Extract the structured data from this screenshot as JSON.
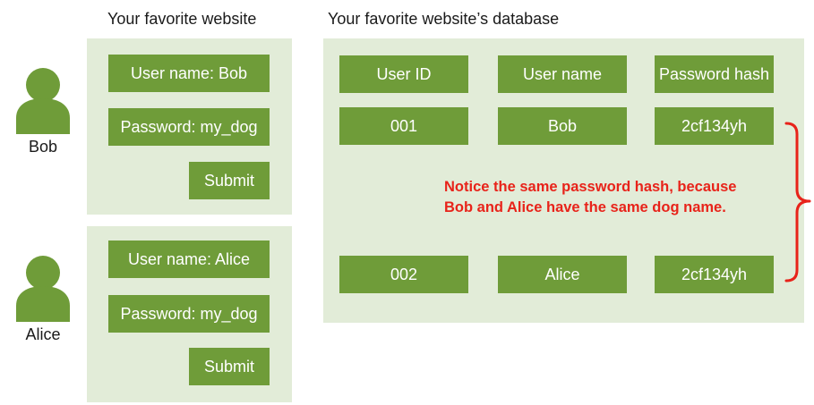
{
  "headings": {
    "website": "Your favorite website",
    "database": "Your favorite website’s database"
  },
  "users": {
    "bob": {
      "name": "Bob",
      "username_field": "User name: Bob",
      "password_field": "Password: my_dog",
      "submit": "Submit"
    },
    "alice": {
      "name": "Alice",
      "username_field": "User name: Alice",
      "password_field": "Password: my_dog",
      "submit": "Submit"
    }
  },
  "database": {
    "columns": [
      "User ID",
      "User name",
      "Password hash"
    ],
    "rows": [
      [
        "001",
        "Bob",
        "2cf134yh"
      ],
      [
        "002",
        "Alice",
        "2cf134yh"
      ]
    ]
  },
  "note": {
    "line1": "Notice the same password hash, because",
    "line2": "Bob and Alice have the same dog name."
  },
  "colors": {
    "box": "#6f9c39",
    "panel": "#e2ecd8",
    "note": "#e8231a",
    "avatar": "#6f9c39"
  },
  "icons": {
    "person": "person-silhouette-icon",
    "bracket": "right-curly-brace-icon"
  }
}
